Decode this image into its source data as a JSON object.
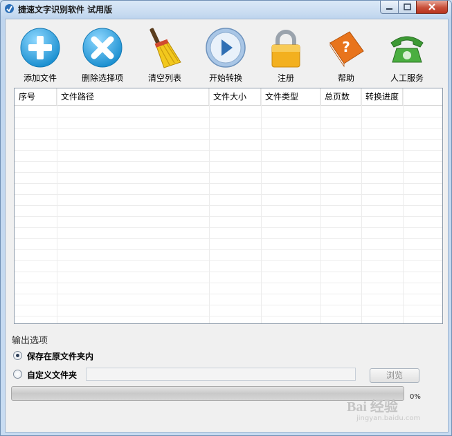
{
  "window": {
    "title": "捷速文字识别软件 试用版",
    "controls": {
      "minimize": "minimize",
      "maximize": "maximize",
      "close": "close"
    }
  },
  "toolbar": [
    {
      "name": "add-file-button",
      "icon": "plus-circle-icon",
      "label": "添加文件",
      "color": "#2aa3dc"
    },
    {
      "name": "delete-selected-button",
      "icon": "x-circle-icon",
      "label": "删除选择项",
      "color": "#2aa3dc"
    },
    {
      "name": "clear-list-button",
      "icon": "broom-icon",
      "label": "清空列表",
      "color": "#e8b316"
    },
    {
      "name": "start-convert-button",
      "icon": "play-circle-icon",
      "label": "开始转换",
      "color": "#2f7fc1"
    },
    {
      "name": "register-button",
      "icon": "padlock-icon",
      "label": "注册",
      "color": "#f0a81a"
    },
    {
      "name": "help-button",
      "icon": "help-book-icon",
      "label": "帮助",
      "color": "#e8741c"
    },
    {
      "name": "support-button",
      "icon": "telephone-icon",
      "label": "人工服务",
      "color": "#3d9a35"
    }
  ],
  "file_table": {
    "columns": [
      "序号",
      "文件路径",
      "文件大小",
      "文件类型",
      "总页数",
      "转换进度"
    ],
    "rows": []
  },
  "output": {
    "section_label": "输出选项",
    "option_original": "保存在原文件夹内",
    "option_custom": "自定义文件夹",
    "selected": "保存在原文件夹内",
    "custom_folder_value": "",
    "browse_label": "浏览"
  },
  "progress": {
    "percent": 0,
    "text": "0%"
  },
  "watermark": {
    "main": "Bai 经验",
    "sub": "jingyan.baidu.com"
  }
}
